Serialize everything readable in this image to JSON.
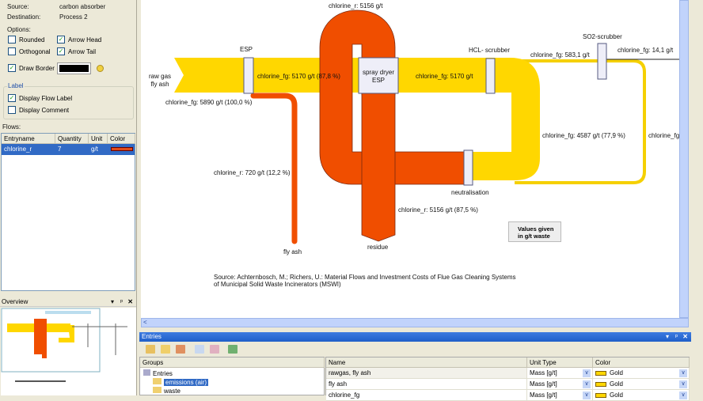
{
  "props": {
    "source_label": "Source:",
    "source_value": "carbon absorber",
    "dest_label": "Destination:",
    "dest_value": "Process 2",
    "options_label": "Options:",
    "rounded": "Rounded",
    "orthogonal": "Orthogonal",
    "arrow_head": "Arrow Head",
    "arrow_tail": "Arrow Tail",
    "draw_border": "Draw Border",
    "border_color": "#000000",
    "label_group": "Label",
    "display_flow_label": "Display Flow Label",
    "display_comment": "Display Comment",
    "check": "✓"
  },
  "flows": {
    "title": "Flows:",
    "headers": [
      "Entryname",
      "Quantity",
      "Unit",
      "Color"
    ],
    "rows": [
      {
        "name": "chlorine_r",
        "quantity": "7",
        "unit": "g/t",
        "color": "#e04b1a"
      }
    ]
  },
  "overview": {
    "title": "Overview"
  },
  "diagram": {
    "labels": {
      "top_r": "chlorine_r: 5156 g/t",
      "esp": "ESP",
      "raw1": "raw gas",
      "raw2": "fly ash",
      "fg1": "chlorine_fg: 5170 g/t (87,8 %)",
      "spray1": "spray dryer",
      "spray2": "ESP",
      "fg2": "chlorine_fg: 5170 g/t",
      "hcl": "HCL- scrubber",
      "fg_in": "chlorine_fg: 5890 g/t (100,0 %)",
      "fg583": "chlorine_fg: 583,1 g/t",
      "so2": "SO2-scrubber",
      "fg14": "chlorine_fg: 14,1 g/t",
      "fg4587": "chlorine_fg: 4587 g/t (77,9 %)",
      "fg_cut": "chlorine_fg",
      "r720": "chlorine_r: 720 g/t (12,2 %)",
      "neut": "neutralisation",
      "r5156": "chlorine_r: 5156 g/t (87,5 %)",
      "flyash": "fly ash",
      "residue": "residue",
      "note1": "Values given",
      "note2": "in g/t waste",
      "src1": "Source: Achternbosch, M.; Richers, U.: Material Flows and Investment Costs of Flue Gas Cleaning Systems",
      "src2": "of Municipal Solid Waste Incinerators (MSWI)"
    },
    "colors": {
      "fg": "#ffd700",
      "r": "#f04e00"
    }
  },
  "entries": {
    "title": "Entries",
    "groups_header": "Groups",
    "tree": [
      "Entries",
      "emissions (air)",
      "waste"
    ],
    "headers": [
      "Name",
      "Unit Type",
      "Color"
    ],
    "rows": [
      {
        "name": "rawgas, fly ash",
        "unit": "Mass [g/t]",
        "color": "Gold"
      },
      {
        "name": "fly ash",
        "unit": "Mass [g/t]",
        "color": "Gold"
      },
      {
        "name": "chlorine_fg",
        "unit": "Mass [g/t]",
        "color": "Gold"
      }
    ]
  }
}
